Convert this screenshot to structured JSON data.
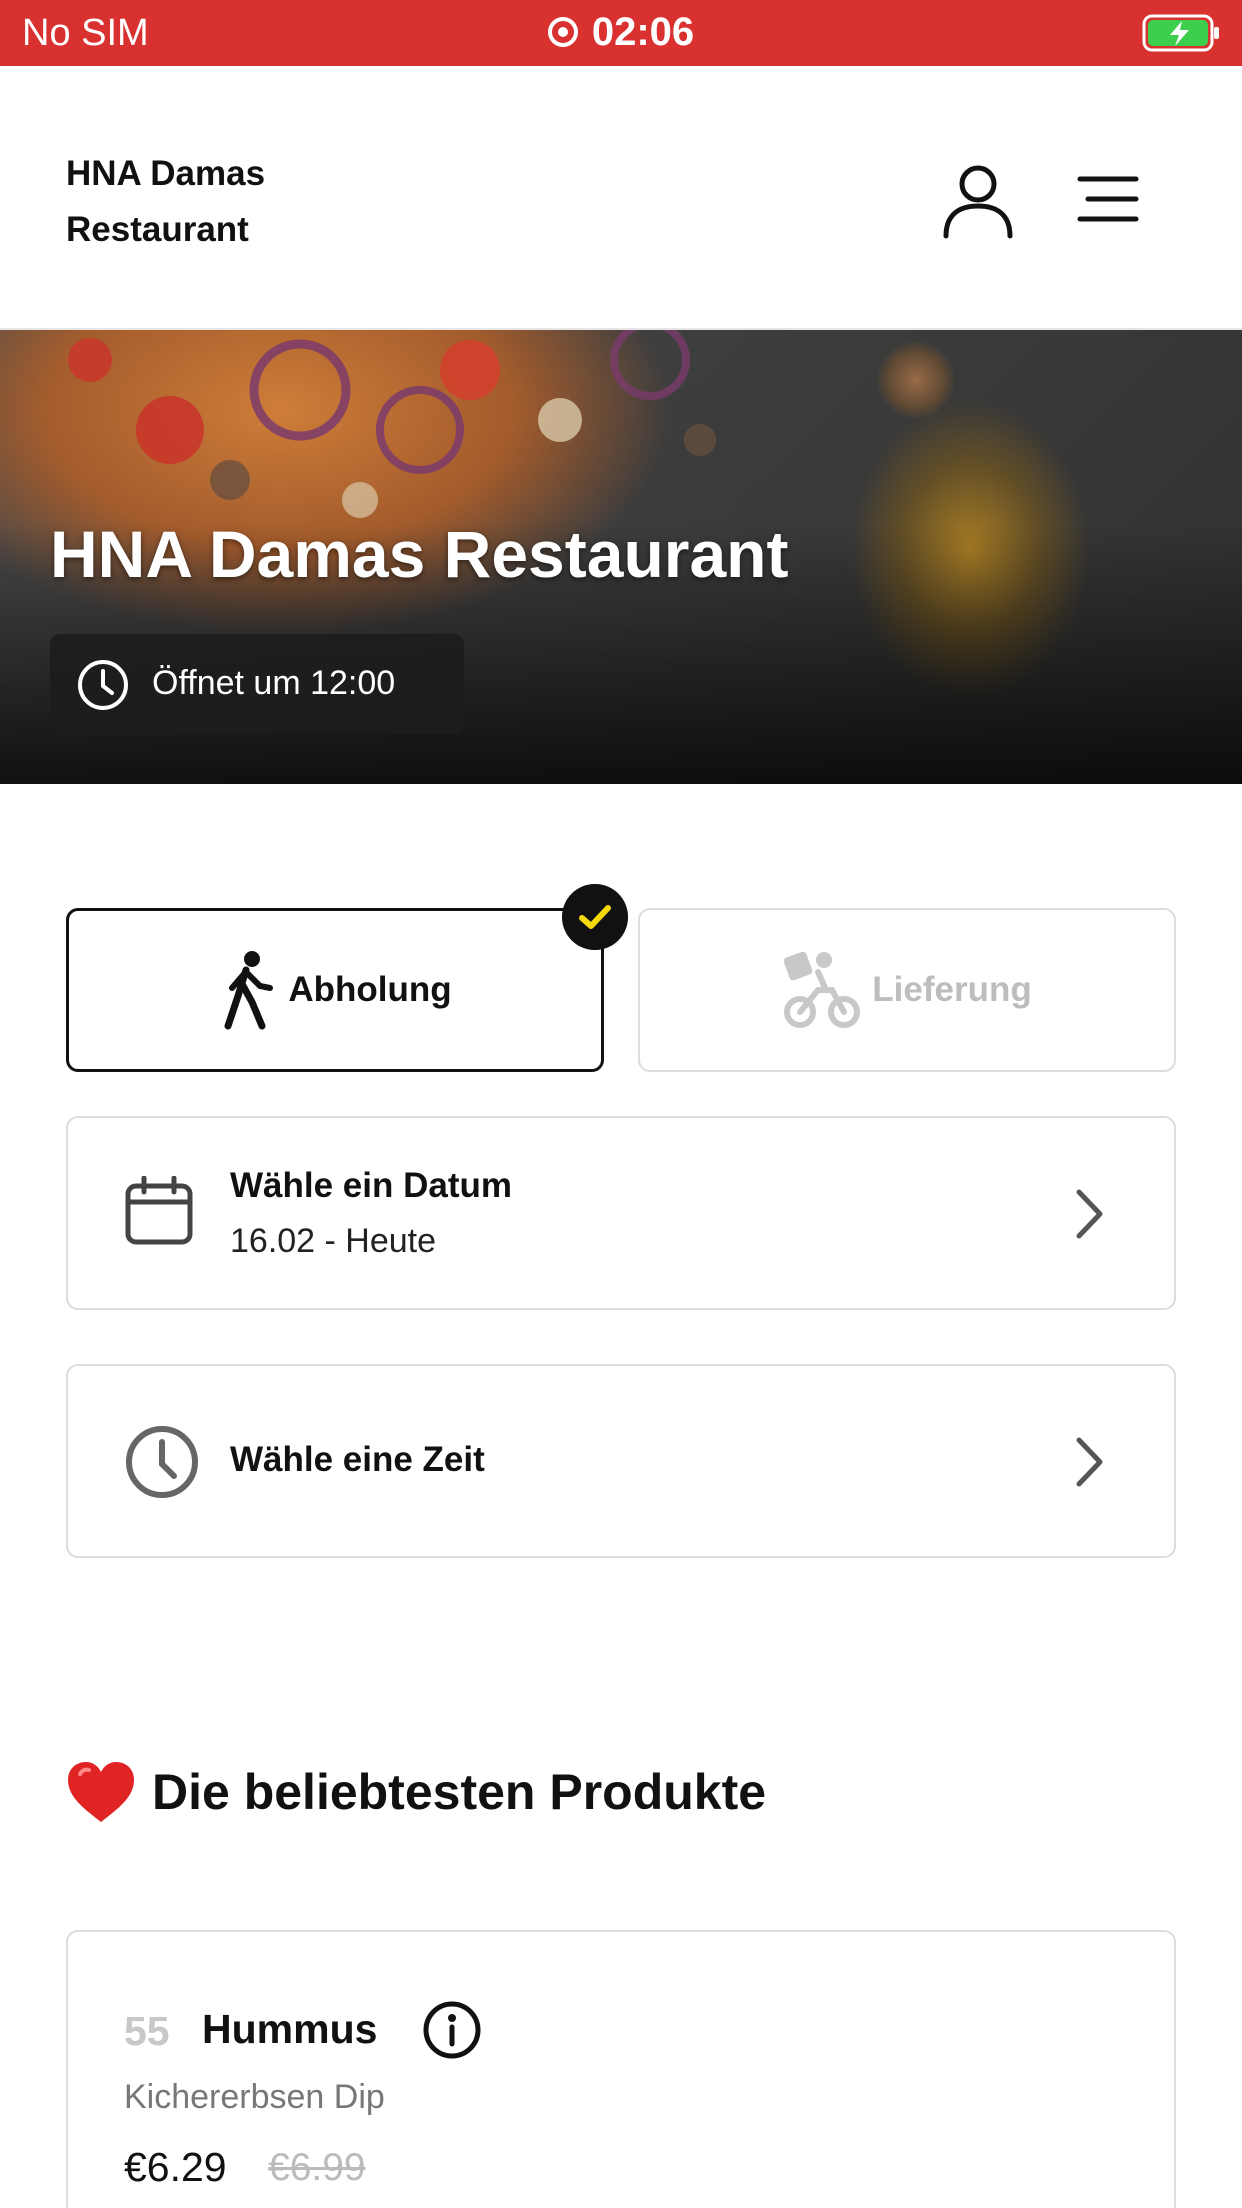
{
  "status_bar": {
    "carrier": "No SIM",
    "time": "02:06"
  },
  "header": {
    "brand_line1": "HNA Damas",
    "brand_line2": "Restaurant"
  },
  "hero": {
    "title": "HNA Damas Restaurant",
    "opening": "Öffnet um 12:00"
  },
  "order_modes": {
    "pickup_label": "Abholung",
    "delivery_label": "Lieferung",
    "selected": "pickup"
  },
  "date_choice": {
    "label": "Wähle ein Datum",
    "value": "16.02 - Heute"
  },
  "time_choice": {
    "label": "Wähle eine Zeit"
  },
  "popular": {
    "title": "Die beliebtesten Produkte",
    "products": [
      {
        "number": "55",
        "name": "Hummus",
        "description": "Kichererbsen Dip",
        "price": "€6.29",
        "old_price": "€6.99"
      }
    ]
  },
  "colors": {
    "status_bar": "#d93030",
    "check_accent": "#f5d90a",
    "battery": "#3ccf4e"
  },
  "icons": [
    "record-icon",
    "battery-icon",
    "user-icon",
    "menu-icon",
    "clock-icon",
    "walking-icon",
    "bike-icon",
    "check-icon",
    "calendar-icon",
    "chevron-right-icon",
    "heart-icon",
    "info-icon"
  ]
}
